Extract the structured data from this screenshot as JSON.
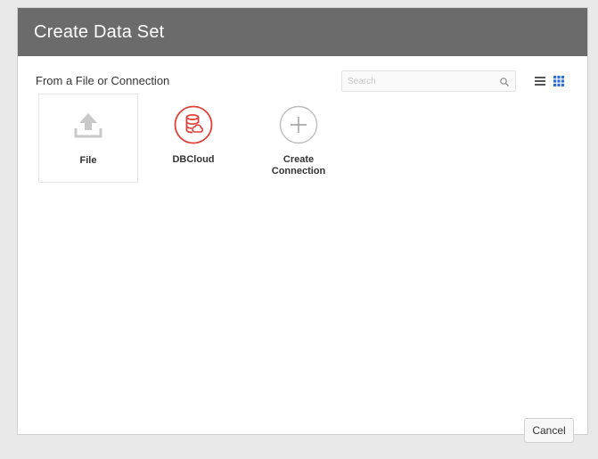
{
  "dialog": {
    "title": "Create Data Set",
    "section_label": "From a File or Connection",
    "search": {
      "placeholder": "Search"
    },
    "view_modes": [
      {
        "name": "list",
        "icon": "list-view-icon"
      },
      {
        "name": "grid",
        "icon": "grid-view-icon",
        "active": true
      }
    ],
    "tiles": [
      {
        "label": "File",
        "icon": "upload-icon",
        "selected": true
      },
      {
        "label": "DBCloud",
        "icon": "database-icon"
      },
      {
        "label": "Create\nConnection",
        "icon": "plus-circle-icon"
      }
    ],
    "cancel_label": "Cancel"
  },
  "colors": {
    "titlebar": "#6b6b6b",
    "database_accent": "#e0403a",
    "grid_active": "#2e6fd6"
  }
}
